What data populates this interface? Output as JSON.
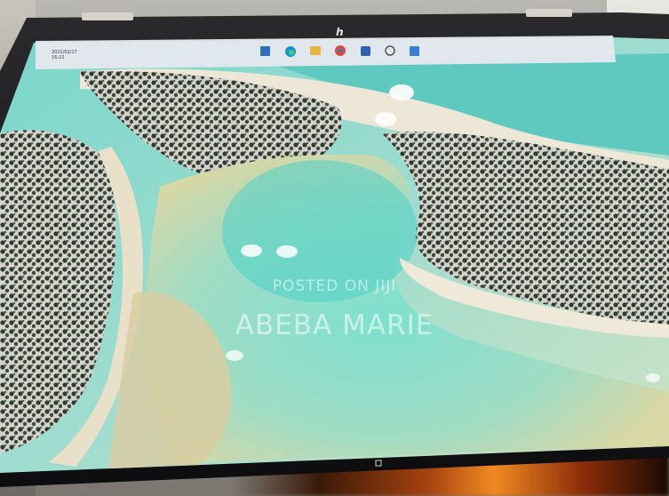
{
  "watermark": {
    "line1": "POSTED ON JIJI",
    "line2": "ABEBA MARIE"
  },
  "taskbar": {
    "date": "2022/02/17",
    "time": "16:22",
    "icons": [
      "start-icon",
      "edge-icon",
      "folder-icon",
      "chrome-icon",
      "store-icon",
      "file-explorer-icon",
      "widgets-icon"
    ]
  },
  "colors": {
    "lagoon": "#6fd1c5",
    "sand": "#d9cfa5",
    "shrub": "#2e3a2a",
    "bezel": "#1c1c1e"
  },
  "logo": "hp"
}
